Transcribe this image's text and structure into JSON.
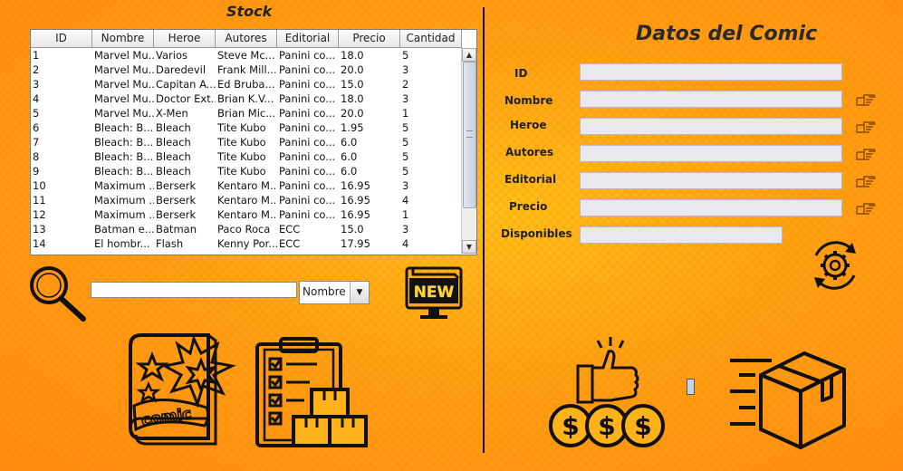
{
  "stock": {
    "title": "Stock",
    "columns": [
      "ID",
      "Nombre",
      "Heroe",
      "Autores",
      "Editorial",
      "Precio",
      "Cantidad"
    ],
    "rows": [
      [
        "1",
        "Marvel Mu...",
        "Varios",
        "Steve Mc...",
        "Panini co...",
        "18.0",
        "5"
      ],
      [
        "2",
        "Marvel Mu...",
        "Daredevil",
        "Frank Mill...",
        "Panini co...",
        "20.0",
        "3"
      ],
      [
        "3",
        "Marvel Mu...",
        "Capitan A...",
        "Ed Bruba...",
        "Panini co...",
        "15.0",
        "2"
      ],
      [
        "4",
        "Marvel Mu...",
        "Doctor Ext...",
        "Brian K.V...",
        "Panini co...",
        "18.0",
        "3"
      ],
      [
        "5",
        "Marvel Mu...",
        "X-Men",
        "Brian Mic...",
        "Panini co...",
        "20.0",
        "1"
      ],
      [
        "6",
        "Bleach: B...",
        "Bleach",
        "Tite Kubo",
        "Panini co...",
        "1.95",
        "5"
      ],
      [
        "7",
        "Bleach: B...",
        "Bleach",
        "Tite Kubo",
        "Panini co...",
        "6.0",
        "5"
      ],
      [
        "8",
        "Bleach: B...",
        "Bleach",
        "Tite Kubo",
        "Panini co...",
        "6.0",
        "5"
      ],
      [
        "9",
        "Bleach: B...",
        "Bleach",
        "Tite Kubo",
        "Panini co...",
        "6.0",
        "5"
      ],
      [
        "10",
        "Maximum ...",
        "Berserk",
        "Kentaro M...",
        "Panini co...",
        "16.95",
        "3"
      ],
      [
        "11",
        "Maximum ...",
        "Berserk",
        "Kentaro M...",
        "Panini co...",
        "16.95",
        "4"
      ],
      [
        "12",
        "Maximum ...",
        "Berserk",
        "Kentaro M...",
        "Panini co...",
        "16.95",
        "1"
      ],
      [
        "13",
        "Batman e...",
        "Batman",
        "Paco Roca",
        "ECC",
        "15.0",
        "3"
      ],
      [
        "14",
        "El hombr...",
        "Flash",
        "Kenny Por...",
        "ECC",
        "17.95",
        "4"
      ]
    ]
  },
  "search": {
    "value": "",
    "filter_selected": "Nombre",
    "search_icon": "magnifier-icon",
    "new_icon": "new-monitor-icon"
  },
  "details": {
    "title": "Datos del Comic",
    "labels": {
      "id": "ID",
      "nombre": "Nombre",
      "heroe": "Heroe",
      "autores": "Autores",
      "editorial": "Editorial",
      "precio": "Precio",
      "disponibles": "Disponibles"
    },
    "values": {
      "id": "",
      "nombre": "",
      "heroe": "",
      "autores": "",
      "editorial": "",
      "precio": "",
      "disponibles": ""
    },
    "edit_icon": "pointing-hand-icon",
    "refresh_icon": "gear-refresh-icon"
  },
  "bottom_icons": {
    "comic": "comic-book-icon",
    "inventory": "clipboard-inventory-icon",
    "sell": "thumbs-up-money-icon",
    "ship": "delivery-box-icon"
  },
  "colors": {
    "background": "#ffa214",
    "ink": "#111111"
  }
}
